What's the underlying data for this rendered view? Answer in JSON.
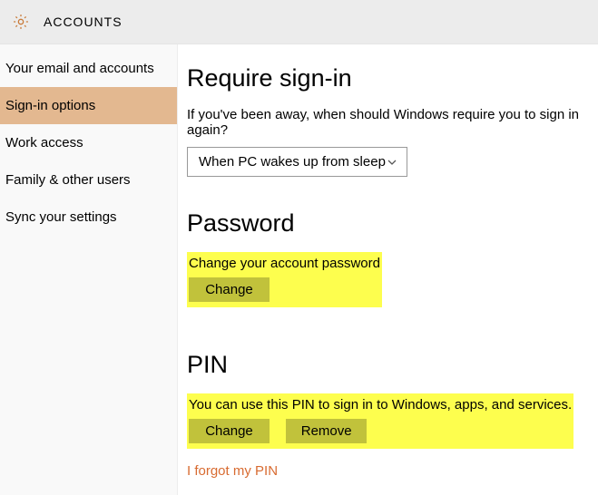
{
  "header": {
    "title": "ACCOUNTS"
  },
  "sidebar": {
    "items": [
      {
        "label": "Your email and accounts"
      },
      {
        "label": "Sign-in options"
      },
      {
        "label": "Work access"
      },
      {
        "label": "Family & other users"
      },
      {
        "label": "Sync your settings"
      }
    ],
    "selected_index": 1
  },
  "require_signin": {
    "title": "Require sign-in",
    "desc": "If you've been away, when should Windows require you to sign in again?",
    "dropdown_value": "When PC wakes up from sleep"
  },
  "password": {
    "title": "Password",
    "desc": "Change your account password",
    "change_label": "Change"
  },
  "pin": {
    "title": "PIN",
    "desc": "You can use this PIN to sign in to Windows, apps, and services.",
    "change_label": "Change",
    "remove_label": "Remove",
    "forgot_link": "I forgot my PIN"
  }
}
